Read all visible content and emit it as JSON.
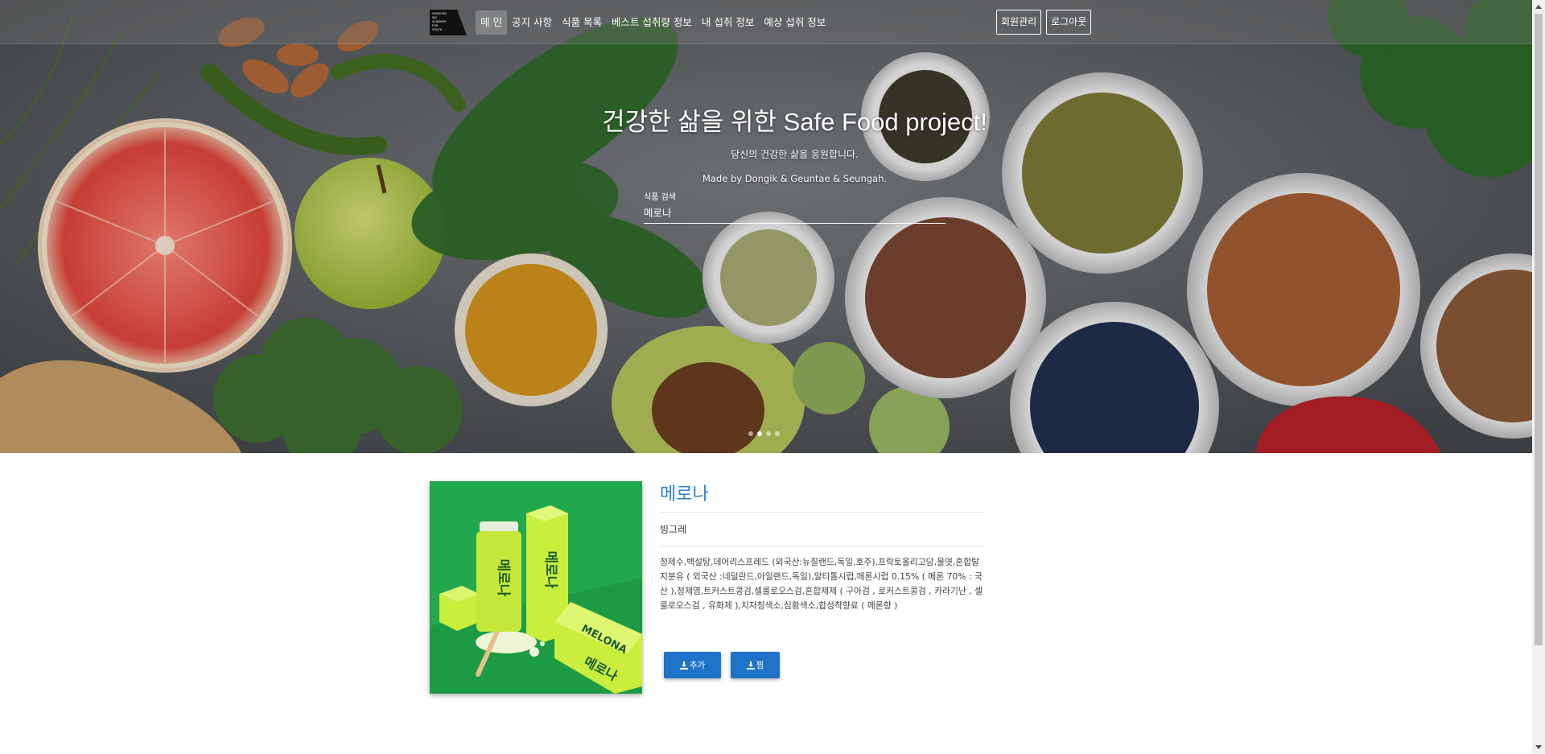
{
  "nav": {
    "logo_lines": [
      "SAMSUNG",
      "SW",
      "ACADEMY",
      "FOR",
      "YOUTH"
    ],
    "links": [
      "메 인",
      "공지 사항",
      "식품 목록",
      "베스트 섭취량 정보",
      "내 섭취 정보",
      "예상 섭취 정보"
    ],
    "active_index": 0,
    "member_admin": "회원관리",
    "logout": "로그아웃"
  },
  "hero": {
    "title": "건강한 삶을 위한 Safe Food project!",
    "subtitle": "당신의 건강한 삶을 응원합니다.",
    "credit": "Made by Dongik & Geuntae & Seungah.",
    "search_label": "식품 검색",
    "search_value": "메로나",
    "carousel_count": 4,
    "carousel_active": 1
  },
  "product": {
    "name": "메로나",
    "maker": "빙그레",
    "ingredients": "정제수,백설탕,데어리스프레드 (외국산:뉴질랜드,독일,호주),프락토올리고당,물엿,혼합탈지분유 ( 외국산 :네덜란드,아일랜드,독일),말티톨시럽,메론시럽 0.15% ( 메론 70% : 국산 ),정제염,트커스트콩검,셀룰로오스검,혼합제제 ( 구아검 , 로커스트콩검 , 카라기난 , 셀룰로오스검 , 유화제 ),치자청색소,심황색소,합성착향료 ( 메론향 )",
    "image_text": "메로나",
    "image_text_en": "MELONA",
    "add_label": "추가",
    "fav_label": "찜"
  },
  "colors": {
    "accent": "#1e73c8",
    "title_blue": "#2a7fd4",
    "product_bg": "#1ea34a",
    "package_green": "#c9ee3c"
  },
  "icons": {
    "add": "download-icon",
    "fav": "download-icon"
  }
}
